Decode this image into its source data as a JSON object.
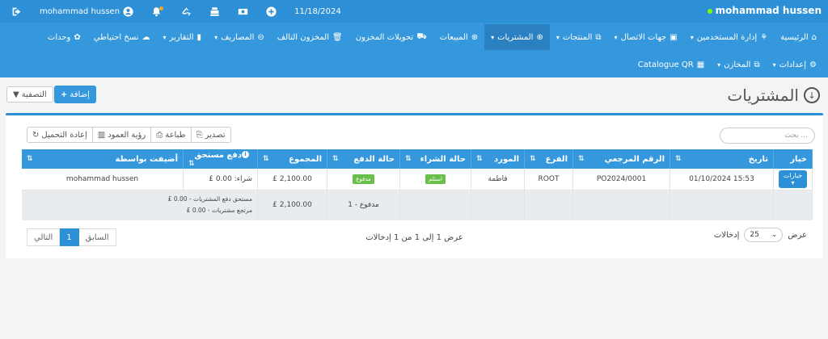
{
  "topbar": {
    "brand": "mohammad hussen",
    "date": "11/18/2024",
    "user": "mohammad hussen"
  },
  "nav": {
    "row1": [
      {
        "label": "الرئيسية",
        "icon": "⌂",
        "caret": false,
        "active": false
      },
      {
        "label": "إدارة المستخدمين",
        "icon": "⚘",
        "caret": true,
        "active": false
      },
      {
        "label": "جهات الاتصال",
        "icon": "▣",
        "caret": true,
        "active": false
      },
      {
        "label": "المنتجات",
        "icon": "⧉",
        "caret": true,
        "active": false
      },
      {
        "label": "المشتريات",
        "icon": "⊕",
        "caret": true,
        "active": true
      },
      {
        "label": "المبيعات",
        "icon": "⊕",
        "caret": false,
        "active": false
      },
      {
        "label": "تحويلات المخزون",
        "icon": "⛟",
        "caret": false,
        "active": false
      },
      {
        "label": "المخزون التالف",
        "icon": "🗑",
        "caret": false,
        "active": false
      },
      {
        "label": "المصاريف",
        "icon": "⊖",
        "caret": true,
        "active": false
      },
      {
        "label": "التقارير",
        "icon": "▮",
        "caret": true,
        "active": false
      },
      {
        "label": "نسخ احتياطي",
        "icon": "☁",
        "caret": false,
        "active": false
      },
      {
        "label": "وحدات",
        "icon": "✿",
        "caret": false,
        "active": false
      }
    ],
    "row2": [
      {
        "label": "إعدادات",
        "icon": "⚙",
        "caret": true,
        "active": false
      },
      {
        "label": "المخازن",
        "icon": "⧉",
        "caret": true,
        "active": false
      },
      {
        "label": "Catalogue QR",
        "icon": "▦",
        "caret": false,
        "active": false
      }
    ]
  },
  "page": {
    "title": "المشتريات",
    "add_label": "إضافة",
    "filter_label": "التصفية"
  },
  "toolbar": {
    "export": "تصدير",
    "print": "طباعة",
    "columns": "رؤية العمود",
    "reload": "إعادة التحميل",
    "search_placeholder": "بحث ..."
  },
  "table": {
    "headers": [
      "خيار",
      "تاريخ",
      "الرقم المرجعي",
      "الفرع",
      "المورد",
      "حالة الشراء",
      "حالة الدفع",
      "المجموع",
      "دفع مستحق",
      "أضيفت بواسطة"
    ],
    "row": {
      "action": "خيارات",
      "date": "15:53 01/10/2024",
      "ref": "PO2024/0001",
      "branch": "ROOT",
      "supplier": "فاطمة",
      "status": "استلم",
      "payment": "مدفوع",
      "total": "2,100.00 £",
      "due": "شراء: 0.00 £",
      "added_by": "mohammad hussen"
    },
    "footer": {
      "paid_count": "مدفوع - 1",
      "total": "2,100.00 £",
      "due_line1": "مستحق دفع المشتريات - 0.00 £",
      "due_line2": "مرتجع مشتريات - 0.00 £"
    }
  },
  "pagination": {
    "show": "عرض",
    "entries": "إدخالات",
    "length": "25",
    "info": "عرض 1 إلى 1 من 1 إدخالات",
    "prev": "السابق",
    "page": "1",
    "next": "التالي"
  }
}
